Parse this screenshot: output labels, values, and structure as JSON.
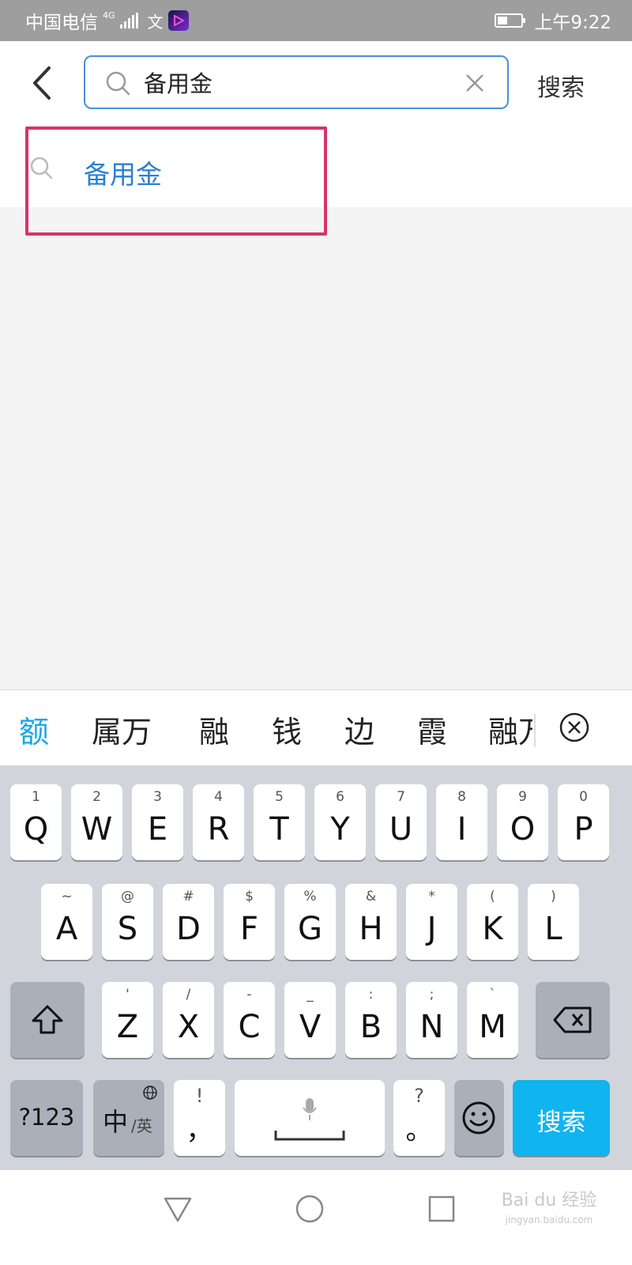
{
  "status_bar": {
    "carrier": "中国电信",
    "network": "4G",
    "app_icon_text": "文",
    "time": "上午9:22"
  },
  "search": {
    "query": "备用金",
    "action_label": "搜索"
  },
  "suggestions": [
    {
      "text": "备用金"
    }
  ],
  "highlight_color": "#d6336c",
  "candidates": {
    "items": [
      "额",
      "属万",
      "融",
      "钱",
      "边",
      "霞"
    ],
    "partial": "融万"
  },
  "keyboard": {
    "row1": [
      {
        "num": "1",
        "letter": "Q"
      },
      {
        "num": "2",
        "letter": "W"
      },
      {
        "num": "3",
        "letter": "E"
      },
      {
        "num": "4",
        "letter": "R"
      },
      {
        "num": "5",
        "letter": "T"
      },
      {
        "num": "6",
        "letter": "Y"
      },
      {
        "num": "7",
        "letter": "U"
      },
      {
        "num": "8",
        "letter": "I"
      },
      {
        "num": "9",
        "letter": "O"
      },
      {
        "num": "0",
        "letter": "P"
      }
    ],
    "row2": [
      {
        "num": "~",
        "letter": "A"
      },
      {
        "num": "@",
        "letter": "S"
      },
      {
        "num": "#",
        "letter": "D"
      },
      {
        "num": "$",
        "letter": "F"
      },
      {
        "num": "%",
        "letter": "G"
      },
      {
        "num": "&",
        "letter": "H"
      },
      {
        "num": "*",
        "letter": "J"
      },
      {
        "num": "(",
        "letter": "K"
      },
      {
        "num": ")",
        "letter": "L"
      }
    ],
    "row3": [
      {
        "num": "'",
        "letter": "Z"
      },
      {
        "num": "/",
        "letter": "X"
      },
      {
        "num": "-",
        "letter": "C"
      },
      {
        "num": "_",
        "letter": "V"
      },
      {
        "num": ":",
        "letter": "B"
      },
      {
        "num": ";",
        "letter": "N"
      },
      {
        "num": "`",
        "letter": "M"
      }
    ],
    "sym_key": "?123",
    "lang_key_main": "中",
    "lang_key_sub": "/英",
    "comma_top": "!",
    "comma_bottom": "，",
    "period_top": "?",
    "period_bottom": "。",
    "enter_label": "搜索",
    "accent_color": "#10b4ef"
  },
  "watermark": {
    "main": "Bai du 经验",
    "sub": "jingyan.baidu.com"
  }
}
